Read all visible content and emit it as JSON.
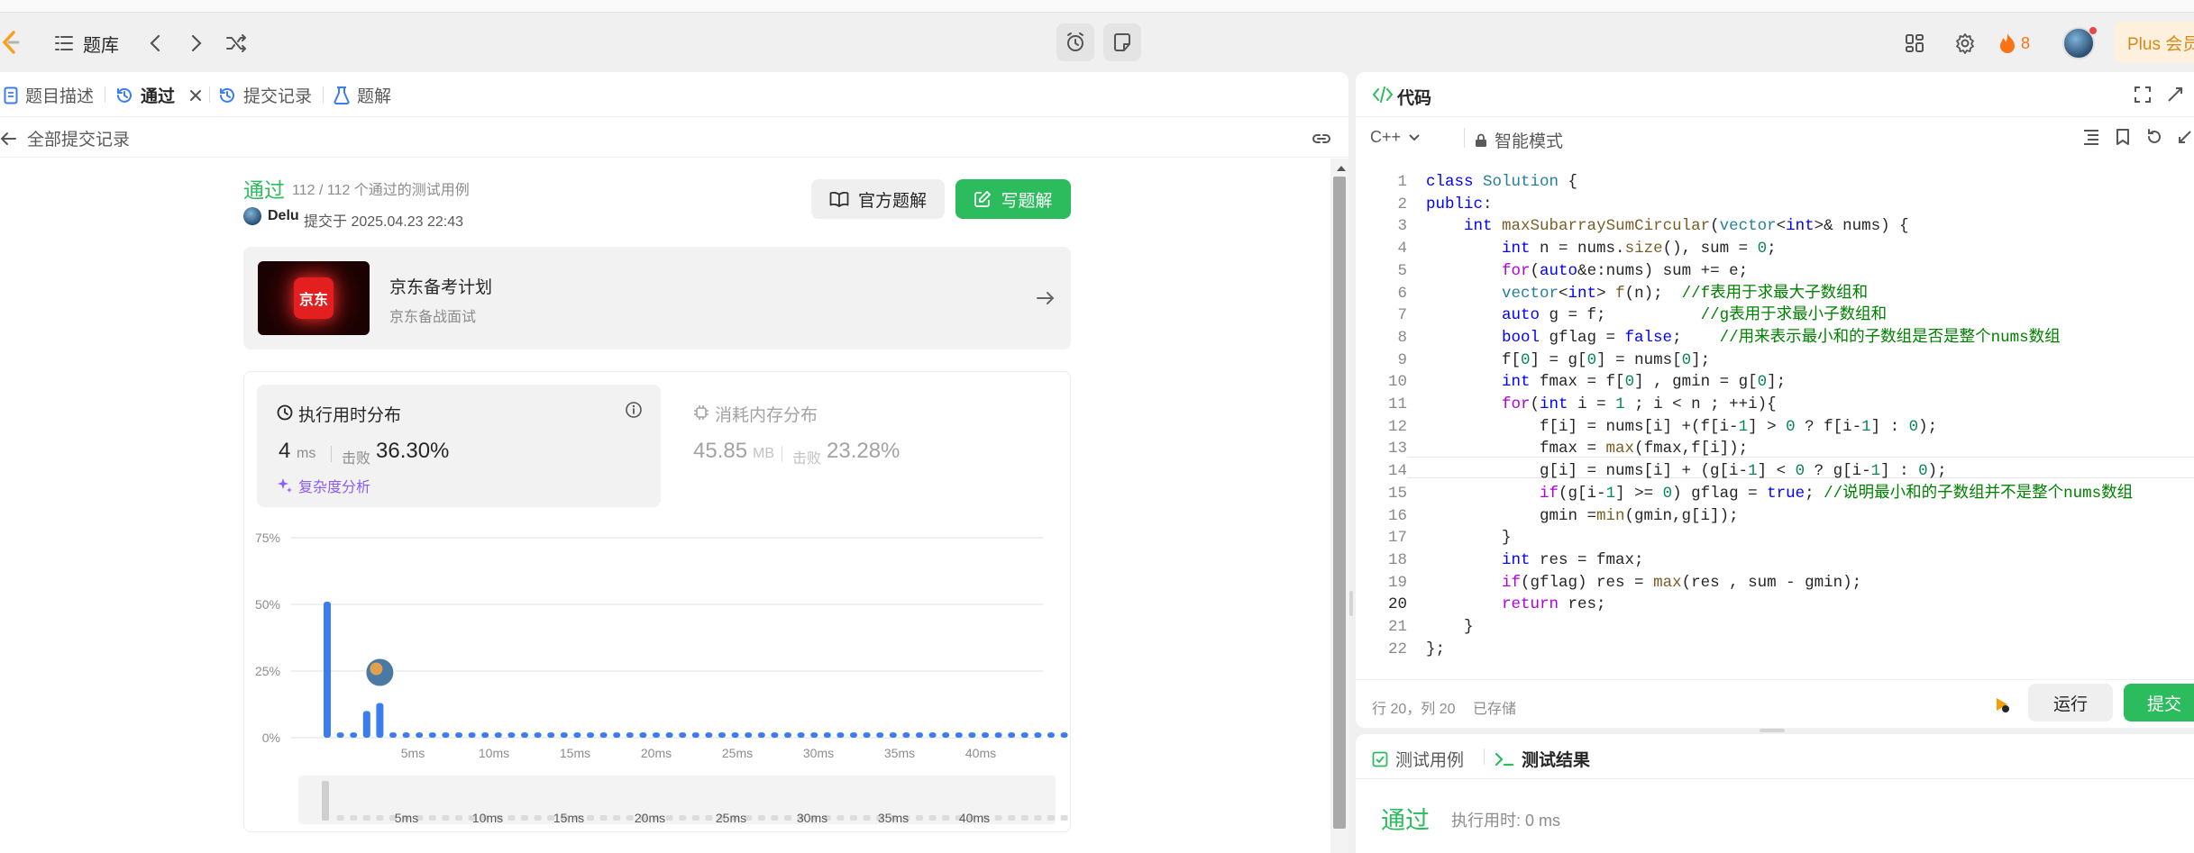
{
  "topbar": {
    "problem_bank": "题库",
    "streak_count": "8",
    "plus_label": "Plus 会员"
  },
  "left": {
    "tabs": {
      "description": "题目描述",
      "accepted": "通过",
      "submissions": "提交记录",
      "solutions": "题解"
    },
    "back_label": "全部提交记录",
    "status": "通过",
    "testcases": "112 / 112 个通过的测试用例",
    "user": "Delu",
    "submitted_at": "提交于 2025.04.23 22:43",
    "official_btn": "官方题解",
    "write_btn": "写题解",
    "promo_logo": "京东",
    "promo_title": "京东备考计划",
    "promo_sub": "京东备战面试",
    "runtime_title": "执行用时分布",
    "runtime_value": "4",
    "runtime_unit": "ms",
    "beat_label": "击败",
    "runtime_beat": "36.30%",
    "complexity_link": "复杂度分析",
    "memory_title": "消耗内存分布",
    "memory_value": "45.85",
    "memory_unit": "MB",
    "memory_beat": "23.28%"
  },
  "chart_data": {
    "type": "bar",
    "y_ticks": [
      "75%",
      "50%",
      "25%",
      "0%"
    ],
    "ylim": [
      0,
      75
    ],
    "x_tick_labels": [
      "5ms",
      "10ms",
      "15ms",
      "20ms",
      "25ms",
      "30ms",
      "35ms",
      "40ms"
    ],
    "values": [
      51,
      2,
      2,
      10,
      13,
      2,
      2,
      2,
      2,
      2,
      2,
      2,
      2,
      2,
      2,
      2,
      2,
      2,
      2,
      2,
      2,
      2,
      2,
      2,
      2,
      2,
      2,
      2,
      2,
      2,
      2,
      2,
      2,
      2,
      2,
      2,
      2,
      2,
      2,
      2,
      2,
      2,
      2,
      2,
      2,
      2,
      2,
      2,
      2,
      2,
      2,
      2,
      2,
      2,
      2,
      2,
      2
    ],
    "highlight_index": 4,
    "bar_color": "#3b7cf0"
  },
  "editor": {
    "title": "代码",
    "language": "C++",
    "mode": "智能模式",
    "status_pos": "行 20，列 20",
    "status_saved": "已存储",
    "run_btn": "运行",
    "submit_btn": "提交"
  },
  "bottom": {
    "tab_testcase": "测试用例",
    "tab_result": "测试结果",
    "result_status": "通过",
    "result_time": "执行用时: 0 ms"
  }
}
